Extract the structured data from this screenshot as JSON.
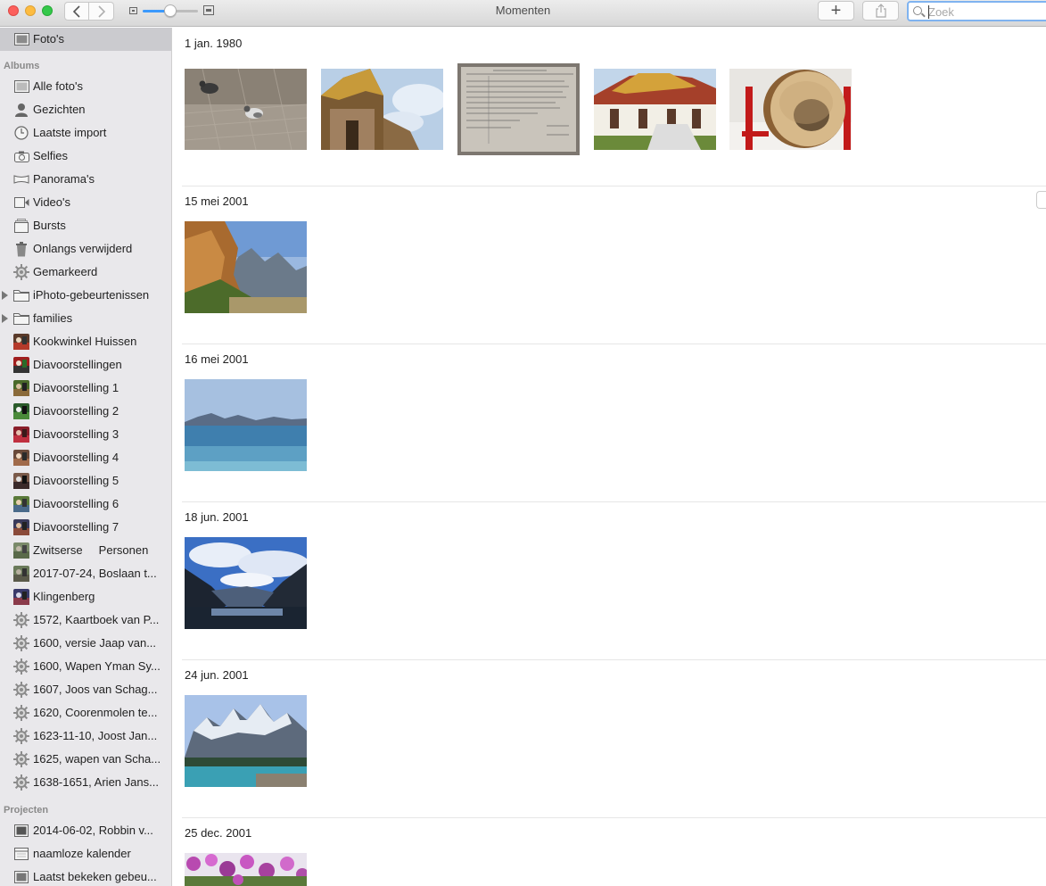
{
  "window": {
    "title": "Momenten"
  },
  "toolbar": {
    "add_label": "+",
    "search_placeholder": "Zoek"
  },
  "sidebar": {
    "top_item": "Foto's",
    "albums_header": "Albums",
    "albums": [
      "Alle foto's",
      "Gezichten",
      "Laatste import",
      "Selfies",
      "Panorama's",
      "Video's",
      "Bursts",
      "Onlangs verwijderd",
      "Gemarkeerd",
      "iPhoto-gebeurtenissen",
      "families",
      "Kookwinkel Huissen",
      "Diavoorstellingen",
      "Diavoorstelling 1",
      "Diavoorstelling 2",
      "Diavoorstelling 3",
      "Diavoorstelling 4",
      "Diavoorstelling 5",
      "Diavoorstelling 6",
      "Diavoorstelling 7",
      "Zwitserse     Personen",
      "2017-07-24, Boslaan t...",
      "Klingenberg",
      "1572, Kaartboek van P...",
      "1600, versie Jaap van...",
      "1600, Wapen Yman Sy...",
      "1607, Joos van Schag...",
      "1620, Coorenmolen te...",
      "1623-11-10, Joost Jan...",
      "1625, wapen van Scha...",
      "1638-1651, Arien Jans..."
    ],
    "projects_header": "Projecten",
    "projects": [
      "2014-06-02, Robbin v...",
      "naamloze kalender",
      "Laatst bekeken gebeu..."
    ]
  },
  "moments": [
    {
      "date": "1 jan. 1980"
    },
    {
      "date": "15 mei 2001"
    },
    {
      "date": "16 mei 2001"
    },
    {
      "date": "18 jun. 2001"
    },
    {
      "date": "24 jun. 2001"
    },
    {
      "date": "25 dec. 2001"
    }
  ]
}
